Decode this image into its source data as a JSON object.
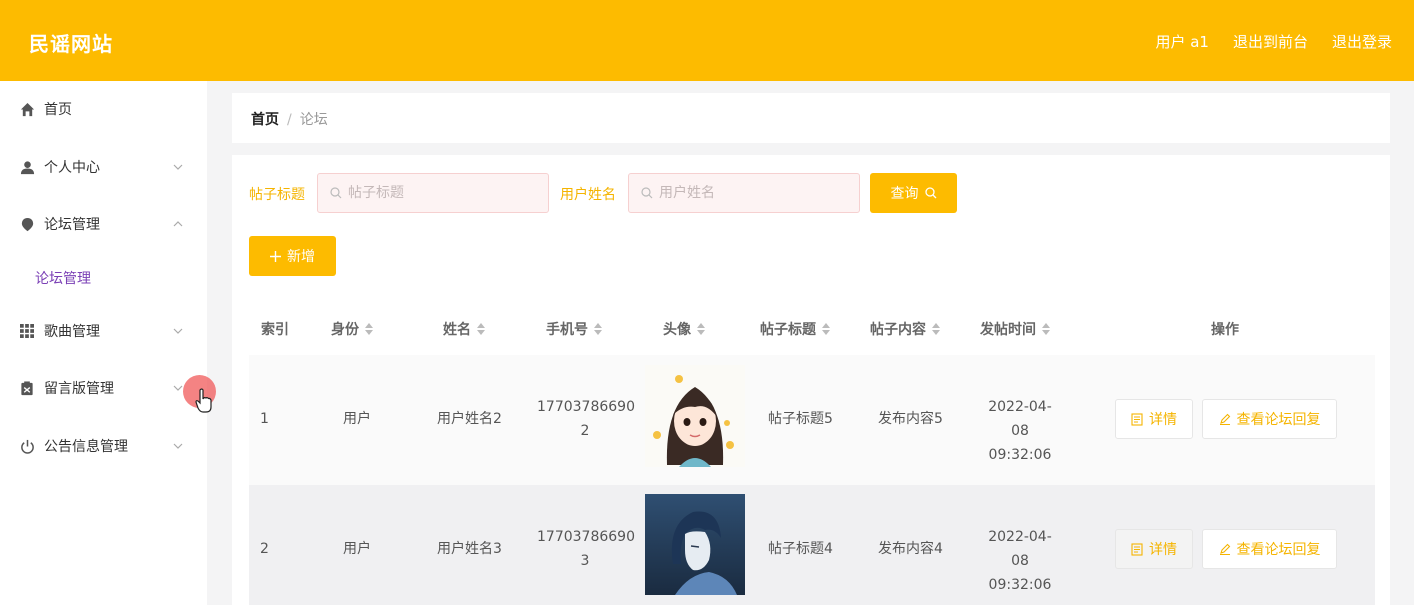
{
  "header": {
    "brand": "民谣网站",
    "user": "用户 a1",
    "goto_front": "退出到前台",
    "logout": "退出登录"
  },
  "sidebar": {
    "items": [
      {
        "label": "首页",
        "icon": "home-icon"
      },
      {
        "label": "个人中心",
        "icon": "user-icon"
      },
      {
        "label": "论坛管理",
        "icon": "location-icon"
      },
      {
        "label": "歌曲管理",
        "icon": "grid-icon"
      },
      {
        "label": "留言版管理",
        "icon": "clipboard-icon"
      },
      {
        "label": "公告信息管理",
        "icon": "power-icon"
      }
    ],
    "sub_item": "论坛管理"
  },
  "breadcrumb": {
    "home": "首页",
    "separator": "/",
    "current": "论坛"
  },
  "filters": {
    "title_label": "帖子标题",
    "title_placeholder": "帖子标题",
    "name_label": "用户姓名",
    "name_placeholder": "用户姓名",
    "query_button": "查询",
    "add_button": "新增"
  },
  "table": {
    "columns": [
      "索引",
      "身份",
      "姓名",
      "手机号",
      "头像",
      "帖子标题",
      "帖子内容",
      "发帖时间",
      "操作"
    ],
    "rows": [
      {
        "index": "1",
        "identity": "用户",
        "name": "用户姓名2",
        "phone_line1": "17703786690",
        "phone_line2": "2",
        "title": "帖子标题5",
        "content": "发布内容5",
        "date": "2022-04-08",
        "time": "09:32:06"
      },
      {
        "index": "2",
        "identity": "用户",
        "name": "用户姓名3",
        "phone_line1": "17703786690",
        "phone_line2": "3",
        "title": "帖子标题4",
        "content": "发布内容4",
        "date": "2022-04-08",
        "time": "09:32:06"
      }
    ],
    "detail_button": "详情",
    "reply_button": "查看论坛回复"
  },
  "colors": {
    "accent": "#fdbb00",
    "sub_item": "#7a3fb5"
  }
}
